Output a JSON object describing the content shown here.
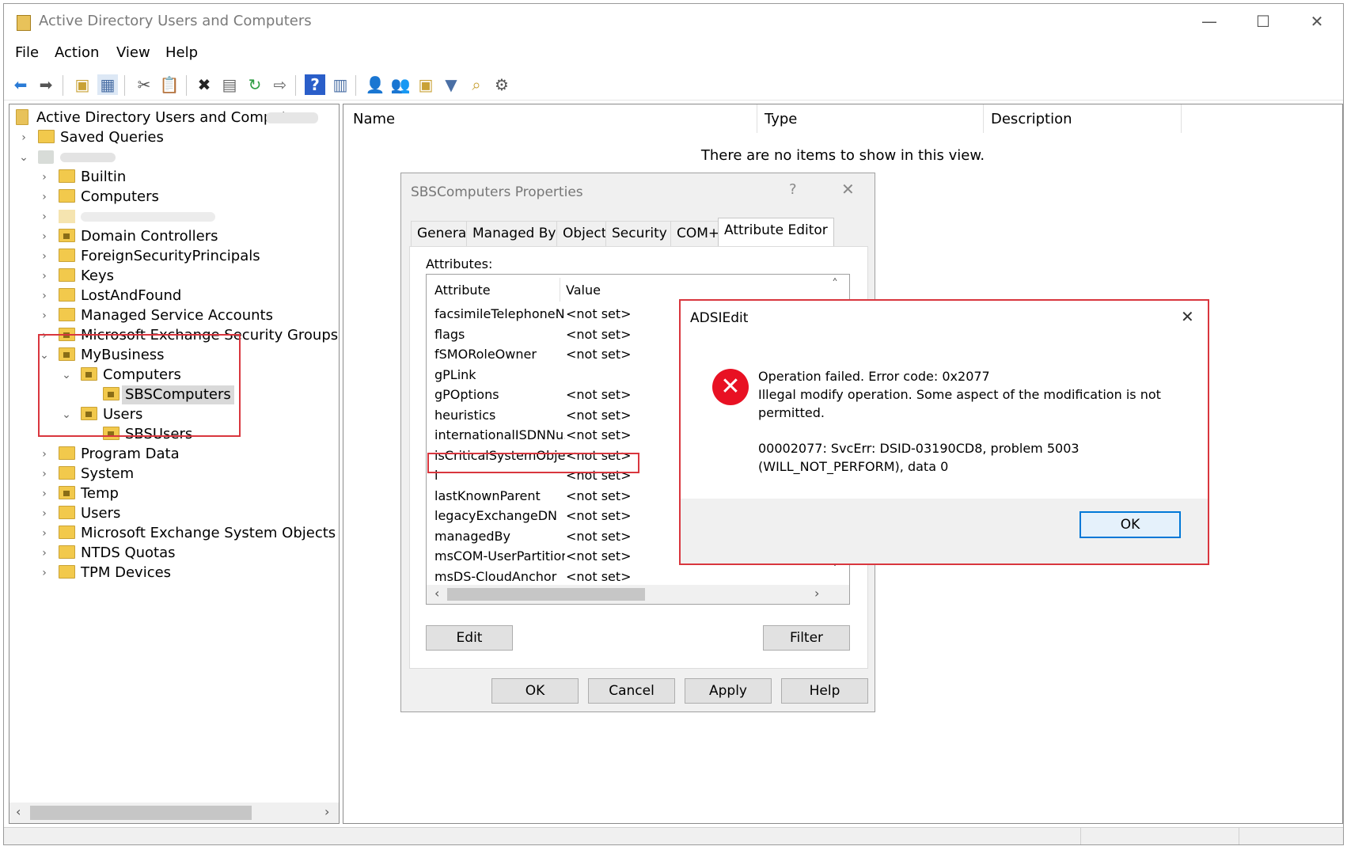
{
  "window": {
    "title": "Active Directory Users and Computers",
    "minimize": "—",
    "maximize": "☐",
    "close": "✕"
  },
  "menu": [
    "File",
    "Action",
    "View",
    "Help"
  ],
  "toolbar": {
    "icons": [
      "back-icon",
      "forward-icon",
      "up-folder-icon",
      "show-tree-icon",
      "cut-icon",
      "copy-icon",
      "delete-icon",
      "properties-icon",
      "refresh-icon",
      "export-icon",
      "help-icon",
      "view-icon",
      "new-user-icon",
      "new-group-icon",
      "new-ou-icon",
      "filter-icon",
      "find-icon",
      "add-member-icon"
    ]
  },
  "tree": {
    "root": "Active Directory Users and Computers",
    "saved_queries": "Saved Queries",
    "nodes": [
      "Builtin",
      "Computers",
      "Domain Controllers",
      "ForeignSecurityPrincipals",
      "Keys",
      "LostAndFound",
      "Managed Service Accounts",
      "Microsoft Exchange Security Groups",
      "MyBusiness",
      "Computers",
      "SBSComputers",
      "Users",
      "SBSUsers",
      "Program Data",
      "System",
      "Temp",
      "Users",
      "Microsoft Exchange System Objects",
      "NTDS Quotas",
      "TPM Devices"
    ]
  },
  "list": {
    "columns": [
      "Name",
      "Type",
      "Description"
    ],
    "empty_message": "There are no items to show in this view."
  },
  "props": {
    "title": "SBSComputers Properties",
    "help": "?",
    "close": "✕",
    "tabs": [
      "General",
      "Managed By",
      "Object",
      "Security",
      "COM+",
      "Attribute Editor"
    ],
    "attributes_label": "Attributes:",
    "col_attribute": "Attribute",
    "col_value": "Value",
    "rows": [
      {
        "name": "facsimileTelephoneN...",
        "value": "<not set>"
      },
      {
        "name": "flags",
        "value": "<not set>"
      },
      {
        "name": "fSMORoleOwner",
        "value": "<not set>"
      },
      {
        "name": "gPLink",
        "value": ""
      },
      {
        "name": "gPOptions",
        "value": "<not set>"
      },
      {
        "name": "heuristics",
        "value": "<not set>"
      },
      {
        "name": "internationalISDNNu...",
        "value": "<not set>"
      },
      {
        "name": "isCriticalSystemObject",
        "value": "<not set>"
      },
      {
        "name": "l",
        "value": "<not set>"
      },
      {
        "name": "lastKnownParent",
        "value": "<not set>"
      },
      {
        "name": "legacyExchangeDN",
        "value": "<not set>"
      },
      {
        "name": "managedBy",
        "value": "<not set>"
      },
      {
        "name": "msCOM-UserPartition...",
        "value": "<not set>"
      },
      {
        "name": "msDS-CloudAnchor",
        "value": "<not set>"
      }
    ],
    "edit": "Edit",
    "filter": "Filter",
    "ok": "OK",
    "cancel": "Cancel",
    "apply": "Apply",
    "help_btn": "Help"
  },
  "error": {
    "title": "ADSIEdit",
    "close": "✕",
    "line1": "Operation failed. Error code: 0x2077",
    "line2": "Illegal modify operation. Some aspect of the modification is not",
    "line3": "permitted.",
    "line4": "00002077: SvcErr: DSID-03190CD8, problem 5003",
    "line5": "(WILL_NOT_PERFORM), data 0",
    "ok": "OK",
    "icon": "error-icon",
    "color": "#e81123"
  }
}
